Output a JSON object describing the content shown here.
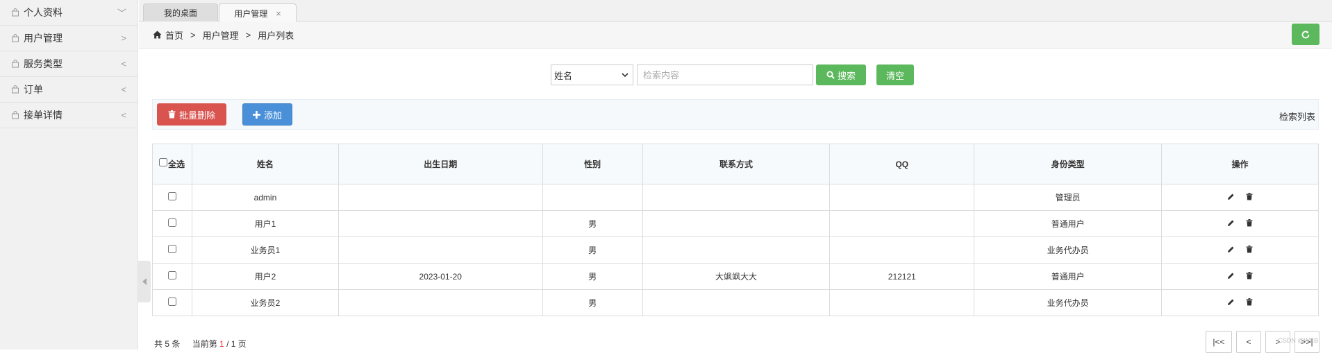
{
  "sidebar": {
    "items": [
      {
        "label": "个人资料",
        "arrow": "﹀"
      },
      {
        "label": "用户管理",
        "arrow": ">"
      },
      {
        "label": "服务类型",
        "arrow": "<"
      },
      {
        "label": "订单",
        "arrow": "<"
      },
      {
        "label": "接单详情",
        "arrow": "<"
      }
    ]
  },
  "tabs": [
    {
      "label": "我的桌面"
    },
    {
      "label": "用户管理",
      "close": "×"
    }
  ],
  "breadcrumb": {
    "home": "首页",
    "level1": "用户管理",
    "level2": "用户列表",
    "sep": ">"
  },
  "search": {
    "select_value": "姓名",
    "placeholder": "检索内容",
    "search_label": "搜索",
    "clear_label": "清空"
  },
  "toolbar": {
    "batch_delete_label": "批量删除",
    "add_label": "添加",
    "title": "检索列表"
  },
  "table": {
    "select_all_label": "全选",
    "columns": [
      "姓名",
      "出生日期",
      "性别",
      "联系方式",
      "QQ",
      "身份类型",
      "操作"
    ],
    "rows": [
      {
        "name": "admin",
        "birth": "",
        "gender": "",
        "contact": "",
        "qq": "",
        "type": "管理员"
      },
      {
        "name": "用户1",
        "birth": "",
        "gender": "男",
        "contact": "",
        "qq": "",
        "type": "普通用户"
      },
      {
        "name": "业务员1",
        "birth": "",
        "gender": "男",
        "contact": "",
        "qq": "",
        "type": "业务代办员"
      },
      {
        "name": "用户2",
        "birth": "2023-01-20",
        "gender": "男",
        "contact": "大飒飒大大",
        "qq": "212121",
        "type": "普通用户"
      },
      {
        "name": "业务员2",
        "birth": "",
        "gender": "男",
        "contact": "",
        "qq": "",
        "type": "业务代办员"
      }
    ]
  },
  "pagination": {
    "total_text": "共 5 条",
    "current_prefix": "当前第",
    "current_page": "1",
    "total_pages": "/ 1 页",
    "first_label": "|<<",
    "prev_label": "<",
    "next_label": ">",
    "last_label": ">>|"
  },
  "watermark": "CSDN @WEB",
  "colors": {
    "green": "#5cb85c",
    "red": "#d9534f",
    "blue": "#4a90d9"
  }
}
